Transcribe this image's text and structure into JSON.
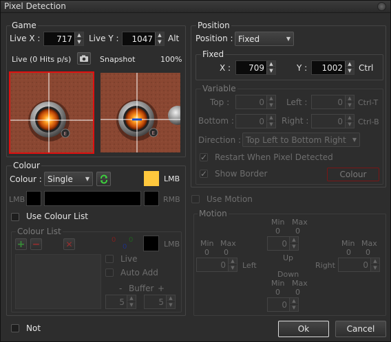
{
  "window": {
    "title": "Pixel Detection"
  },
  "game": {
    "group_label": "Game",
    "live_x_label": "Live X :",
    "live_x_value": "717",
    "live_y_label": "Live Y :",
    "live_y_value": "1047",
    "alt_label": "Alt",
    "live_status": "Live (0 Hits p/s)",
    "snapshot_label": "Snapshot",
    "zoom": "100%"
  },
  "colour": {
    "group_label": "Colour",
    "colour_label": "Colour :",
    "colour_mode": "Single",
    "lmb_label": "LMB",
    "lmb_swatch_color": "#ffc83d",
    "lmb_left_label": "LMB",
    "rmb_label": "RMB",
    "use_colour_list_label": "Use Colour List"
  },
  "colour_list": {
    "group_label": "Colour List",
    "rgb_r": "0",
    "rgb_g": "0",
    "rgb_b": "0",
    "lmb_label": "LMB",
    "live_label": "Live",
    "auto_add_label": "Auto Add",
    "buffer_minus": "-",
    "buffer_label": "Buffer",
    "buffer_plus": "+",
    "buffer_left": "5",
    "buffer_right": "5"
  },
  "position": {
    "group_label": "Position",
    "position_label": "Position :",
    "position_mode": "Fixed"
  },
  "fixed": {
    "group_label": "Fixed",
    "x_label": "X :",
    "x_value": "709",
    "y_label": "Y :",
    "y_value": "1002",
    "ctrl_label": "Ctrl"
  },
  "variable": {
    "group_label": "Variable",
    "top_label": "Top :",
    "top_value": "0",
    "left_label": "Left :",
    "left_value": "0",
    "ctrl_t": "Ctrl-T",
    "bottom_label": "Bottom :",
    "bottom_value": "0",
    "right_label": "Right :",
    "right_value": "0",
    "ctrl_b": "Ctrl-B",
    "direction_label": "Direction :",
    "direction_value": "Top Left to Bottom Right",
    "restart_label": "Restart When Pixel Detected",
    "show_border_label": "Show Border",
    "colour_button": "Colour"
  },
  "motion": {
    "use_motion_label": "Use Motion",
    "group_label": "Motion",
    "min_label": "Min",
    "max_label": "Max",
    "zero": "0",
    "up_label": "Up",
    "left_label": "Left",
    "right_label": "Right",
    "down_label": "Down",
    "up_value": "0",
    "left_value": "0",
    "right_value": "0",
    "down_value": "0"
  },
  "footer": {
    "not_label": "Not",
    "ok_label": "Ok",
    "cancel_label": "Cancel"
  }
}
